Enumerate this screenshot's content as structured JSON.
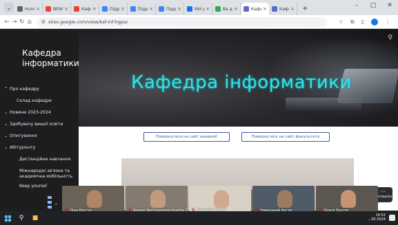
{
  "browser": {
    "tabs": [
      {
        "label": "Human",
        "color": "#5f6368",
        "active": false
      },
      {
        "label": "NEW!",
        "color": "#ea4335",
        "active": false
      },
      {
        "label": "Кафед",
        "color": "#ea4335",
        "active": false
      },
      {
        "label": "Підру",
        "color": "#4285f4",
        "active": false
      },
      {
        "label": "Підру",
        "color": "#4285f4",
        "active": false
      },
      {
        "label": "Підру",
        "color": "#4285f4",
        "active": false
      },
      {
        "label": "Мої р",
        "color": "#1a73e8",
        "active": false
      },
      {
        "label": "Ва до",
        "color": "#34a853",
        "active": false
      },
      {
        "label": "Кафед",
        "color": "#5c6bc0",
        "active": true
      },
      {
        "label": "Кафед",
        "color": "#5c6bc0",
        "active": false
      }
    ],
    "new_tab": "+",
    "url": "sites.google.com/view/kaf-inf-hgpa/"
  },
  "site": {
    "title_line1": "Кафедра",
    "title_line2": "інформатики",
    "hero_title": "Кафедра інформатики",
    "nav": [
      {
        "label": "Про кафедру",
        "chevron": "^",
        "level": 0
      },
      {
        "label": "Склад кафедри",
        "chevron": "",
        "level": 1
      },
      {
        "label": "Новини 2023-2024",
        "chevron": "v",
        "level": 0
      },
      {
        "label": "Здобувачу вищої освіти",
        "chevron": "v",
        "level": 0
      },
      {
        "label": "Опитування",
        "chevron": "v",
        "level": 0
      },
      {
        "label": "Абітурієнту",
        "chevron": "v",
        "level": 0
      },
      {
        "label": "Дистанційне навчання",
        "chevron": "",
        "level": 2
      },
      {
        "label": "Міжнародні зв'язки та академічна мобільність",
        "chevron": "",
        "level": 3
      },
      {
        "label": "Keep yoursel",
        "chevron": "",
        "level": 2
      }
    ],
    "button_academy": "Повернутися на сайт академії",
    "button_faculty": "Повернутися на сайт факультету"
  },
  "meet": {
    "shown_more_label": "Докладніше",
    "participants": [
      {
        "name": "Ліца Костук"
      },
      {
        "name": "Roman Nechiporenko Kharkiv Gym..."
      },
      {
        "name": "Михайло Заїтків"
      },
      {
        "name": "Новицький Артур"
      },
      {
        "name": "Олеся Зозуля"
      }
    ]
  },
  "taskbar": {
    "time": "14:52",
    "date": "...02.2024"
  }
}
